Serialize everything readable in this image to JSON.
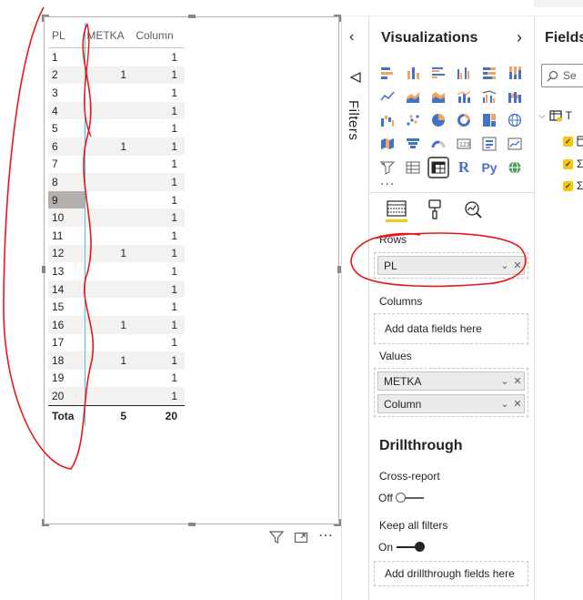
{
  "matrix": {
    "headers": [
      "PL",
      "METKA",
      "Column"
    ],
    "rows": [
      {
        "pl": "1",
        "metka": "",
        "column": "1"
      },
      {
        "pl": "2",
        "metka": "1",
        "column": "1"
      },
      {
        "pl": "3",
        "metka": "",
        "column": "1"
      },
      {
        "pl": "4",
        "metka": "",
        "column": "1"
      },
      {
        "pl": "5",
        "metka": "",
        "column": "1"
      },
      {
        "pl": "6",
        "metka": "1",
        "column": "1"
      },
      {
        "pl": "7",
        "metka": "",
        "column": "1"
      },
      {
        "pl": "8",
        "metka": "",
        "column": "1"
      },
      {
        "pl": "9",
        "metka": "",
        "column": "1"
      },
      {
        "pl": "10",
        "metka": "",
        "column": "1"
      },
      {
        "pl": "11",
        "metka": "",
        "column": "1"
      },
      {
        "pl": "12",
        "metka": "1",
        "column": "1"
      },
      {
        "pl": "13",
        "metka": "",
        "column": "1"
      },
      {
        "pl": "14",
        "metka": "",
        "column": "1"
      },
      {
        "pl": "15",
        "metka": "",
        "column": "1"
      },
      {
        "pl": "16",
        "metka": "1",
        "column": "1"
      },
      {
        "pl": "17",
        "metka": "",
        "column": "1"
      },
      {
        "pl": "18",
        "metka": "1",
        "column": "1"
      },
      {
        "pl": "19",
        "metka": "",
        "column": "1"
      },
      {
        "pl": "20",
        "metka": "",
        "column": "1"
      }
    ],
    "selected_row": "9",
    "total": {
      "pl": "Tota",
      "metka": "5",
      "column": "20"
    }
  },
  "visual_header_icons": [
    "filter-icon",
    "focus-mode-icon",
    "more-options-icon"
  ],
  "filters": {
    "label": "Filters",
    "collapse_icon": "chevron-left-icon"
  },
  "visualizations": {
    "title": "Visualizations",
    "expand_icon": "chevron-right-icon",
    "more": "...",
    "r_label": "R",
    "py_label": "Py",
    "tabs": [
      "fields-tab",
      "format-tab",
      "analytics-tab"
    ],
    "rows_label": "Rows",
    "rows_fields": [
      "PL"
    ],
    "columns_label": "Columns",
    "columns_placeholder": "Add data fields here",
    "values_label": "Values",
    "values_fields": [
      "METKA",
      "Column"
    ],
    "drillthrough_title": "Drillthrough",
    "cross_report_label": "Cross-report",
    "cross_report_state": "Off",
    "keep_filters_label": "Keep all filters",
    "keep_filters_state": "On",
    "drill_placeholder": "Add drillthrough fields here"
  },
  "fields": {
    "title": "Fields",
    "search_placeholder": "Se",
    "table_initial": "T",
    "items": [
      "Σ",
      "Σ"
    ]
  },
  "colors": {
    "accent_yellow": "#f2c811",
    "annotation_red": "#e8171c",
    "selected_cell": "#b3b0ad",
    "divider_cyan": "#4fc3d9"
  }
}
